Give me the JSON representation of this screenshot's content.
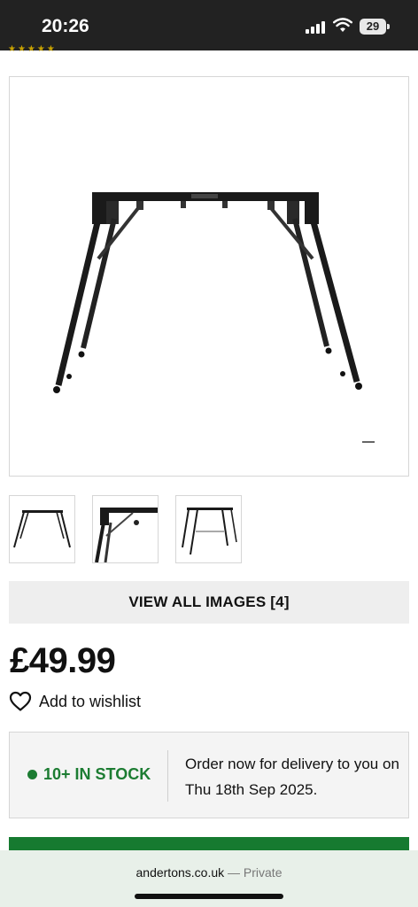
{
  "status_bar": {
    "time": "20:26",
    "battery_level": "29",
    "icons": [
      "signal-icon",
      "wifi-icon",
      "battery-icon"
    ]
  },
  "product": {
    "view_all_label": "VIEW ALL IMAGES [4]",
    "price": "£49.99",
    "wishlist_label": "Add to wishlist",
    "stock_label": "10+ IN STOCK",
    "delivery_text": "Order now for delivery to you on Thu 18th Sep 2025."
  },
  "browser": {
    "domain": "andertons.co.uk",
    "separator": " — ",
    "mode": "Private"
  },
  "colors": {
    "status_bar_bg": "#222222",
    "stock_green": "#1c7c32",
    "basket_green": "#167a30",
    "footer_bg": "#e8f0e9"
  }
}
